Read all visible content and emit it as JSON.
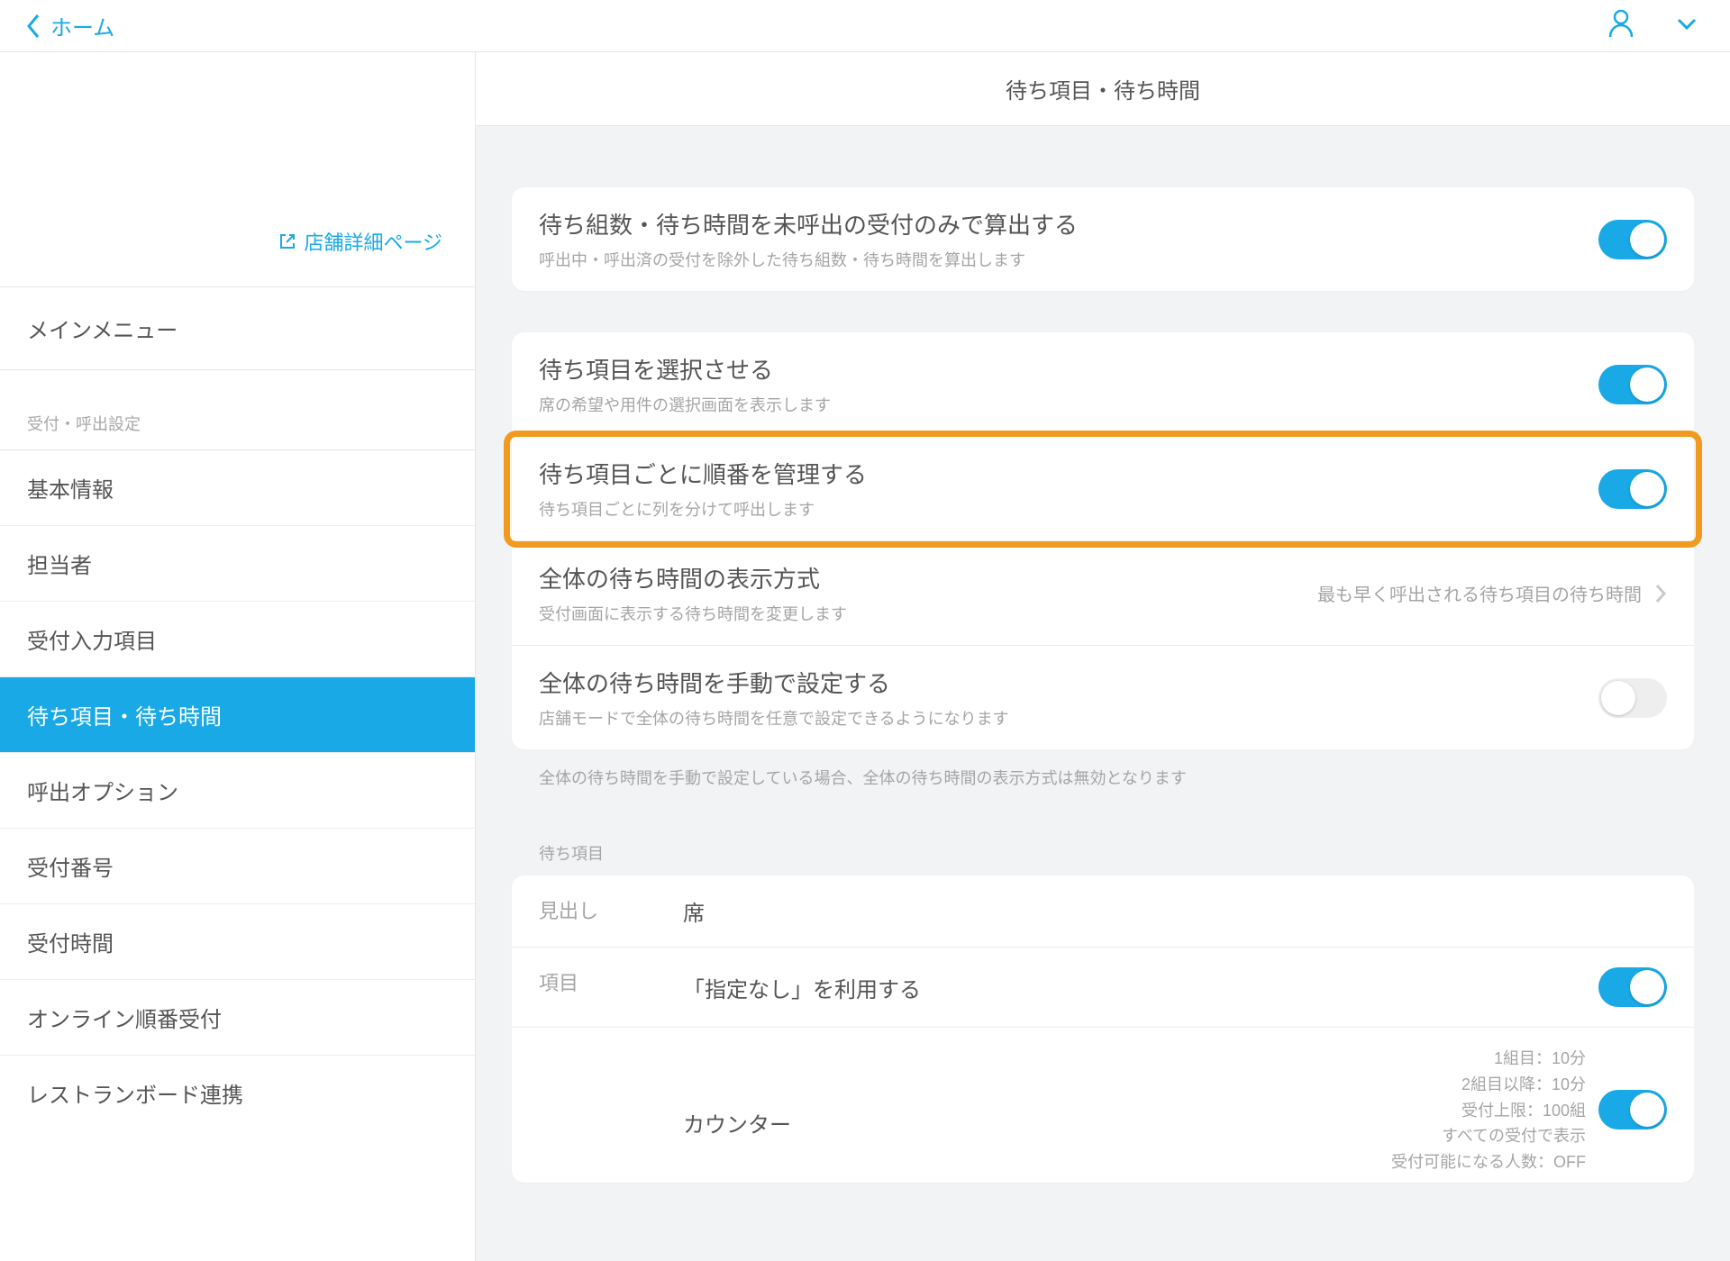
{
  "topbar": {
    "back_label": "ホーム"
  },
  "sidebar": {
    "store_link": "店舗詳細ページ",
    "main_menu": "メインメニュー",
    "section_label": "受付・呼出設定",
    "items": [
      {
        "label": "基本情報"
      },
      {
        "label": "担当者"
      },
      {
        "label": "受付入力項目"
      },
      {
        "label": "待ち項目・待ち時間"
      },
      {
        "label": "呼出オプション"
      },
      {
        "label": "受付番号"
      },
      {
        "label": "受付時間"
      },
      {
        "label": "オンライン順番受付"
      },
      {
        "label": "レストランボード連携"
      }
    ]
  },
  "page": {
    "title": "待ち項目・待ち時間"
  },
  "group1": {
    "title": "待ち組数・待ち時間を未呼出の受付のみで算出する",
    "sub": "呼出中・呼出済の受付を除外した待ち組数・待ち時間を算出します"
  },
  "group2": {
    "r1": {
      "title": "待ち項目を選択させる",
      "sub": "席の希望や用件の選択画面を表示します"
    },
    "r2": {
      "title": "待ち項目ごとに順番を管理する",
      "sub": "待ち項目ごとに列を分けて呼出します"
    },
    "r3": {
      "title": "全体の待ち時間の表示方式",
      "sub": "受付画面に表示する待ち時間を変更します",
      "value": "最も早く呼出される待ち項目の待ち時間"
    },
    "r4": {
      "title": "全体の待ち時間を手動で設定する",
      "sub": "店舗モードで全体の待ち時間を任意で設定できるようになります"
    },
    "note": "全体の待ち時間を手動で設定している場合、全体の待ち時間の表示方式は無効となります"
  },
  "wait_items": {
    "section_label": "待ち項目",
    "heading_label": "見出し",
    "heading_value": "席",
    "items_label": "項目",
    "use_none_label": "「指定なし」を利用する",
    "counter": {
      "name": "カウンター",
      "line1": "1組目：10分",
      "line2": "2組目以降：10分",
      "line3": "受付上限：100組",
      "line4": "すべての受付で表示",
      "line5": "受付可能になる人数：OFF"
    }
  }
}
